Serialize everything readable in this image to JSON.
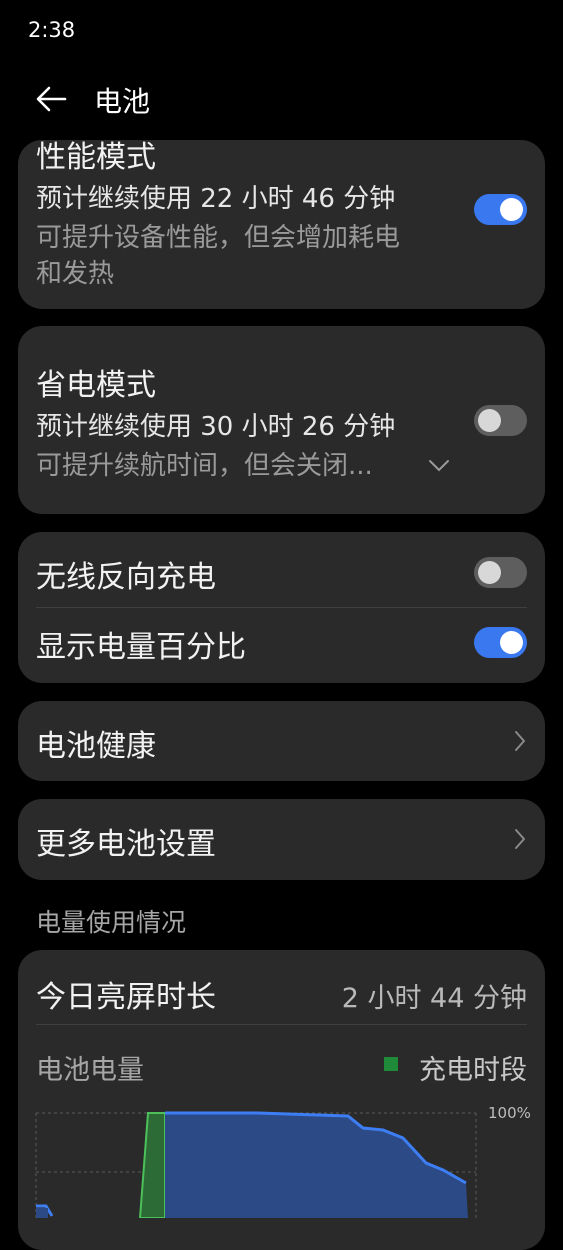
{
  "status_bar": {
    "time": "2:38"
  },
  "header": {
    "title": "电池"
  },
  "performance_mode": {
    "title": "性能模式",
    "estimate": "预计继续使用 22 小时 46 分钟",
    "description_line1": "可提升设备性能，但会增加耗电",
    "description_line2": "和发热",
    "enabled": true
  },
  "power_saving_mode": {
    "title": "省电模式",
    "estimate": "预计继续使用 30 小时 26 分钟",
    "description": "可提升续航时间，但会关闭...",
    "enabled": false
  },
  "toggles": [
    {
      "label": "无线反向充电",
      "enabled": false
    },
    {
      "label": "显示电量百分比",
      "enabled": true
    }
  ],
  "links": {
    "battery_health": "电池健康",
    "more_settings": "更多电池设置"
  },
  "usage": {
    "section_label": "电量使用情况",
    "screen_on_label": "今日亮屏时长",
    "screen_on_value": "2 小时 44 分钟",
    "chart_title": "电池电量",
    "legend_charging": "充电时段",
    "y_max_label": "100%"
  },
  "colors": {
    "toggle_on": "#3a78f0",
    "charging": "#1f8a3a",
    "battery_line": "#3e7ef5"
  }
}
